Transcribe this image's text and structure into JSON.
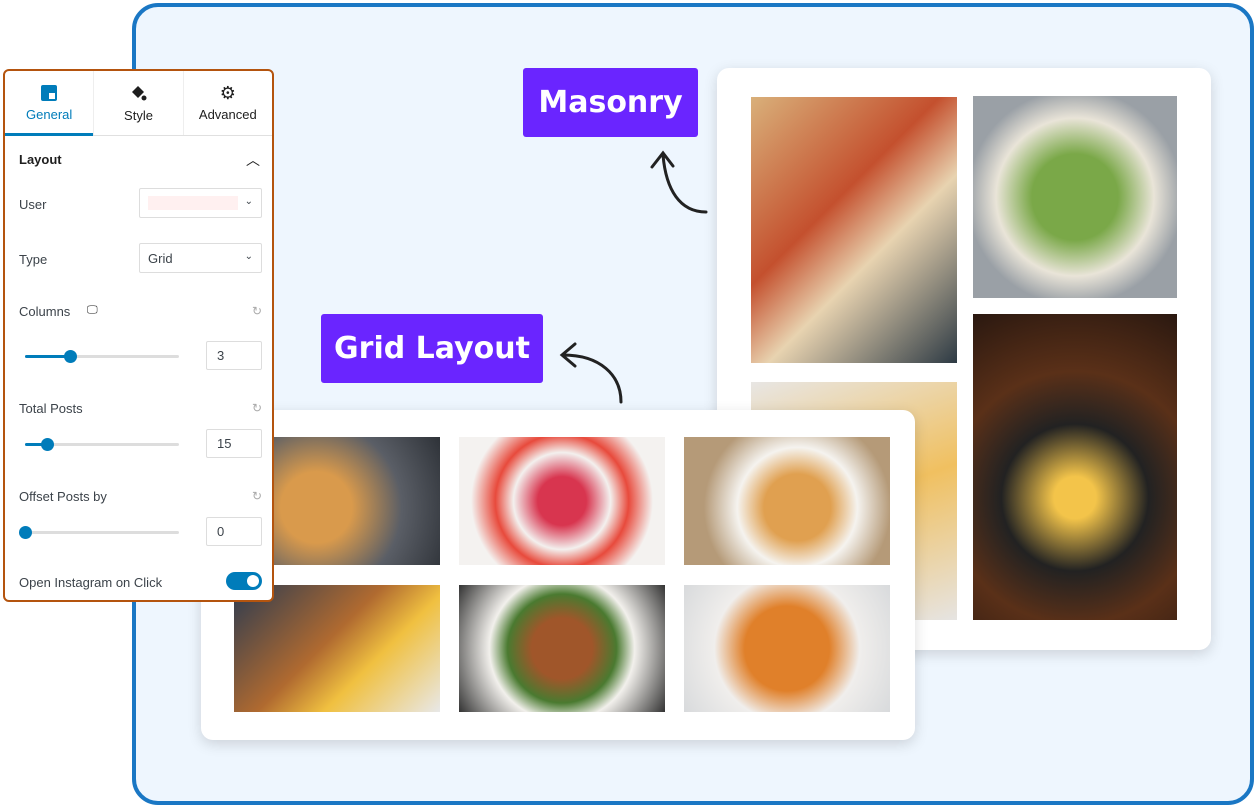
{
  "labels": {
    "masonry": "Masonry",
    "grid": "Grid Layout"
  },
  "colors": {
    "accent": "#007cba",
    "label_bg": "#6a25ff",
    "frame": "#1a77c4",
    "panel_border": "#b4540e"
  },
  "panel": {
    "tabs": [
      {
        "label": "General",
        "icon": "layout-icon",
        "active": true
      },
      {
        "label": "Style",
        "icon": "paint-bucket-icon"
      },
      {
        "label": "Advanced",
        "icon": "gear-icon"
      }
    ],
    "section": "Layout",
    "user": {
      "label": "User",
      "value": ""
    },
    "type": {
      "label": "Type",
      "value": "Grid"
    },
    "columns": {
      "label": "Columns",
      "value": "3",
      "slider_percent": 29
    },
    "total_posts": {
      "label": "Total Posts",
      "value": "15",
      "slider_percent": 14
    },
    "offset": {
      "label": "Offset Posts by",
      "value": "0",
      "slider_percent": 0
    },
    "open_instagram": {
      "label": "Open Instagram on Click",
      "enabled": true
    }
  }
}
